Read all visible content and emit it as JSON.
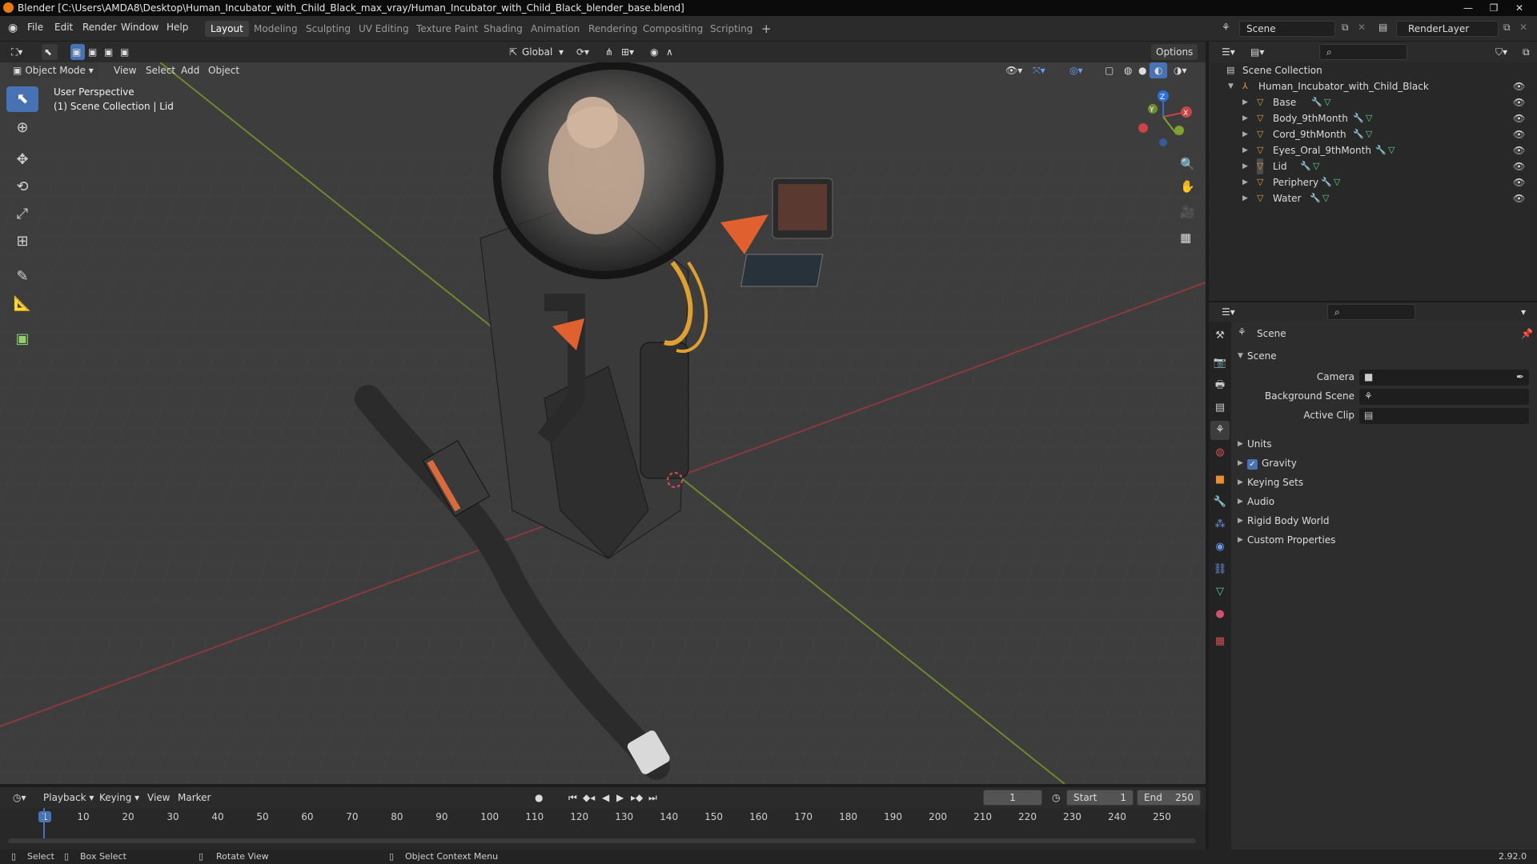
{
  "window": {
    "title": "Blender [C:\\Users\\AMDA8\\Desktop\\Human_Incubator_with_Child_Black_max_vray/Human_Incubator_with_Child_Black_blender_base.blend]"
  },
  "menu": [
    "File",
    "Edit",
    "Render",
    "Window",
    "Help"
  ],
  "workspaces": [
    "Layout",
    "Modeling",
    "Sculpting",
    "UV Editing",
    "Texture Paint",
    "Shading",
    "Animation",
    "Rendering",
    "Compositing",
    "Scripting"
  ],
  "active_workspace": "Layout",
  "scene_selector": "Scene",
  "renderlayer_selector": "RenderLayer",
  "viewport": {
    "mode": "Object Mode",
    "header_menus": [
      "View",
      "Select",
      "Add",
      "Object"
    ],
    "orientation": "Global",
    "options_label": "Options",
    "overlay_title": "User Perspective",
    "overlay_subtitle": "(1) Scene Collection | Lid",
    "gizmo_axes": [
      "X",
      "Y",
      "Z"
    ]
  },
  "outliner": {
    "root": "Scene Collection",
    "collection": "Human_Incubator_with_Child_Black",
    "objects": [
      "Base",
      "Body_9thMonth",
      "Cord_9thMonth",
      "Eyes_Oral_9thMonth",
      "Lid",
      "Periphery",
      "Water"
    ]
  },
  "properties": {
    "header": "Scene",
    "panel_title": "Scene",
    "fields": [
      {
        "label": "Camera",
        "value": ""
      },
      {
        "label": "Background Scene",
        "value": ""
      },
      {
        "label": "Active Clip",
        "value": ""
      }
    ],
    "panels": [
      "Units",
      "Gravity",
      "Keying Sets",
      "Audio",
      "Rigid Body World",
      "Custom Properties"
    ],
    "gravity_checked": true
  },
  "timeline": {
    "menus": [
      "Playback",
      "Keying",
      "View",
      "Marker"
    ],
    "current_frame": "1",
    "start_label": "Start",
    "start_value": "1",
    "end_label": "End",
    "end_value": "250",
    "ticks": [
      "1",
      "10",
      "20",
      "30",
      "40",
      "50",
      "60",
      "70",
      "80",
      "90",
      "100",
      "110",
      "120",
      "130",
      "140",
      "150",
      "160",
      "170",
      "180",
      "190",
      "200",
      "210",
      "220",
      "230",
      "240",
      "250"
    ]
  },
  "statusbar": {
    "select": "Select",
    "box_select": "Box Select",
    "rotate": "Rotate View",
    "context": "Object Context Menu",
    "version": "2.92.0"
  },
  "colors": {
    "accent": "#4772b3",
    "x_axis": "#c64545",
    "y_axis": "#7ea130",
    "viewport_bg": "#3d3d3d",
    "orange": "#e87d0d"
  }
}
